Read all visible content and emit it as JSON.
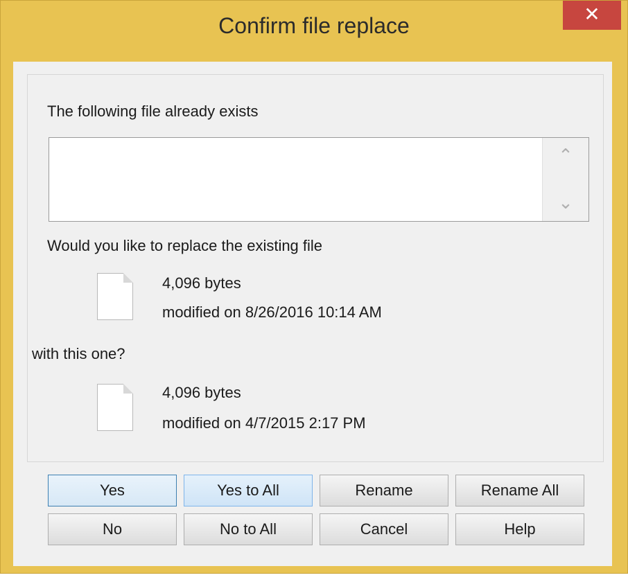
{
  "window": {
    "title": "Confirm file replace",
    "close_glyph": "✕"
  },
  "dialog": {
    "exists_label": "The following file already exists",
    "replace_question": "Would you like to replace the existing file",
    "with_label": "with this one?",
    "existing_file": {
      "size": "4,096 bytes",
      "modified": "modified on 8/26/2016 10:14 AM",
      "icon": "file-icon"
    },
    "new_file": {
      "size": "4,096 bytes",
      "modified": "modified on 4/7/2015 2:17 PM",
      "icon": "file-icon"
    },
    "scroll_up_glyph": "⌃",
    "scroll_down_glyph": "⌄"
  },
  "buttons": {
    "yes": "Yes",
    "yes_to_all": "Yes to All",
    "rename": "Rename",
    "rename_all": "Rename All",
    "no": "No",
    "no_to_all": "No to All",
    "cancel": "Cancel",
    "help": "Help"
  },
  "colors": {
    "frame": "#e8c352",
    "close_button": "#c7463f",
    "client": "#f0f0f0"
  }
}
